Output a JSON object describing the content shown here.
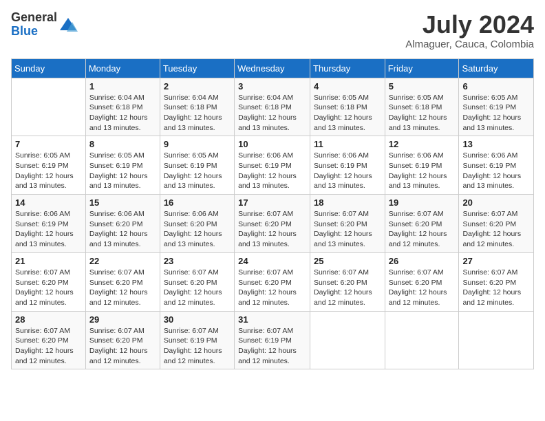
{
  "logo": {
    "general": "General",
    "blue": "Blue"
  },
  "title": {
    "month_year": "July 2024",
    "location": "Almaguer, Cauca, Colombia"
  },
  "days_header": [
    "Sunday",
    "Monday",
    "Tuesday",
    "Wednesday",
    "Thursday",
    "Friday",
    "Saturday"
  ],
  "weeks": [
    [
      {
        "day": "",
        "info": ""
      },
      {
        "day": "1",
        "info": "Sunrise: 6:04 AM\nSunset: 6:18 PM\nDaylight: 12 hours and 13 minutes."
      },
      {
        "day": "2",
        "info": "Sunrise: 6:04 AM\nSunset: 6:18 PM\nDaylight: 12 hours and 13 minutes."
      },
      {
        "day": "3",
        "info": "Sunrise: 6:04 AM\nSunset: 6:18 PM\nDaylight: 12 hours and 13 minutes."
      },
      {
        "day": "4",
        "info": "Sunrise: 6:05 AM\nSunset: 6:18 PM\nDaylight: 12 hours and 13 minutes."
      },
      {
        "day": "5",
        "info": "Sunrise: 6:05 AM\nSunset: 6:18 PM\nDaylight: 12 hours and 13 minutes."
      },
      {
        "day": "6",
        "info": "Sunrise: 6:05 AM\nSunset: 6:19 PM\nDaylight: 12 hours and 13 minutes."
      }
    ],
    [
      {
        "day": "7",
        "info": "Sunrise: 6:05 AM\nSunset: 6:19 PM\nDaylight: 12 hours and 13 minutes."
      },
      {
        "day": "8",
        "info": "Sunrise: 6:05 AM\nSunset: 6:19 PM\nDaylight: 12 hours and 13 minutes."
      },
      {
        "day": "9",
        "info": "Sunrise: 6:05 AM\nSunset: 6:19 PM\nDaylight: 12 hours and 13 minutes."
      },
      {
        "day": "10",
        "info": "Sunrise: 6:06 AM\nSunset: 6:19 PM\nDaylight: 12 hours and 13 minutes."
      },
      {
        "day": "11",
        "info": "Sunrise: 6:06 AM\nSunset: 6:19 PM\nDaylight: 12 hours and 13 minutes."
      },
      {
        "day": "12",
        "info": "Sunrise: 6:06 AM\nSunset: 6:19 PM\nDaylight: 12 hours and 13 minutes."
      },
      {
        "day": "13",
        "info": "Sunrise: 6:06 AM\nSunset: 6:19 PM\nDaylight: 12 hours and 13 minutes."
      }
    ],
    [
      {
        "day": "14",
        "info": "Sunrise: 6:06 AM\nSunset: 6:19 PM\nDaylight: 12 hours and 13 minutes."
      },
      {
        "day": "15",
        "info": "Sunrise: 6:06 AM\nSunset: 6:20 PM\nDaylight: 12 hours and 13 minutes."
      },
      {
        "day": "16",
        "info": "Sunrise: 6:06 AM\nSunset: 6:20 PM\nDaylight: 12 hours and 13 minutes."
      },
      {
        "day": "17",
        "info": "Sunrise: 6:07 AM\nSunset: 6:20 PM\nDaylight: 12 hours and 13 minutes."
      },
      {
        "day": "18",
        "info": "Sunrise: 6:07 AM\nSunset: 6:20 PM\nDaylight: 12 hours and 13 minutes."
      },
      {
        "day": "19",
        "info": "Sunrise: 6:07 AM\nSunset: 6:20 PM\nDaylight: 12 hours and 12 minutes."
      },
      {
        "day": "20",
        "info": "Sunrise: 6:07 AM\nSunset: 6:20 PM\nDaylight: 12 hours and 12 minutes."
      }
    ],
    [
      {
        "day": "21",
        "info": "Sunrise: 6:07 AM\nSunset: 6:20 PM\nDaylight: 12 hours and 12 minutes."
      },
      {
        "day": "22",
        "info": "Sunrise: 6:07 AM\nSunset: 6:20 PM\nDaylight: 12 hours and 12 minutes."
      },
      {
        "day": "23",
        "info": "Sunrise: 6:07 AM\nSunset: 6:20 PM\nDaylight: 12 hours and 12 minutes."
      },
      {
        "day": "24",
        "info": "Sunrise: 6:07 AM\nSunset: 6:20 PM\nDaylight: 12 hours and 12 minutes."
      },
      {
        "day": "25",
        "info": "Sunrise: 6:07 AM\nSunset: 6:20 PM\nDaylight: 12 hours and 12 minutes."
      },
      {
        "day": "26",
        "info": "Sunrise: 6:07 AM\nSunset: 6:20 PM\nDaylight: 12 hours and 12 minutes."
      },
      {
        "day": "27",
        "info": "Sunrise: 6:07 AM\nSunset: 6:20 PM\nDaylight: 12 hours and 12 minutes."
      }
    ],
    [
      {
        "day": "28",
        "info": "Sunrise: 6:07 AM\nSunset: 6:20 PM\nDaylight: 12 hours and 12 minutes."
      },
      {
        "day": "29",
        "info": "Sunrise: 6:07 AM\nSunset: 6:20 PM\nDaylight: 12 hours and 12 minutes."
      },
      {
        "day": "30",
        "info": "Sunrise: 6:07 AM\nSunset: 6:19 PM\nDaylight: 12 hours and 12 minutes."
      },
      {
        "day": "31",
        "info": "Sunrise: 6:07 AM\nSunset: 6:19 PM\nDaylight: 12 hours and 12 minutes."
      },
      {
        "day": "",
        "info": ""
      },
      {
        "day": "",
        "info": ""
      },
      {
        "day": "",
        "info": ""
      }
    ]
  ]
}
